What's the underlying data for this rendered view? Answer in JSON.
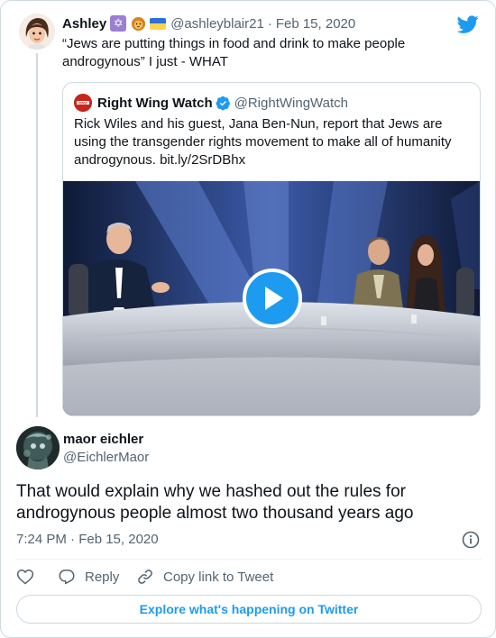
{
  "parent_tweet": {
    "display_name": "Ashley",
    "badges": [
      "star-of-david-emoji",
      "lion-emoji",
      "ukraine-flag-emoji"
    ],
    "handle": "@ashleyblair21",
    "separator": "·",
    "date": "Feb 15, 2020",
    "text": "“Jews are putting things in food and drink to make people androgynous” I just - WHAT"
  },
  "quoted_tweet": {
    "display_name": "Right Wing Watch",
    "verified": true,
    "handle": "@RightWingWatch",
    "text": "Rick Wiles and his guest, Jana Ben-Nun, report that Jews are using the transgender rights movement to make all of humanity androgynous. bit.ly/2SrDBhx",
    "media": {
      "type": "video",
      "icon": "play-icon"
    }
  },
  "reply_tweet": {
    "display_name": "maor eichler",
    "handle": "@EichlerMaor",
    "text": "That would explain why we hashed out the rules for androgynous people almost two thousand years ago",
    "timestamp": "7:24 PM · Feb 15, 2020"
  },
  "actions": {
    "like_icon": "heart-icon",
    "reply_label": "Reply",
    "copy_label": "Copy link to Tweet"
  },
  "footer": {
    "explore_label": "Explore what's happening on Twitter"
  },
  "colors": {
    "accent": "#1d9bf0",
    "text": "#0f1419",
    "muted": "#536471",
    "border": "#cfd9de"
  }
}
